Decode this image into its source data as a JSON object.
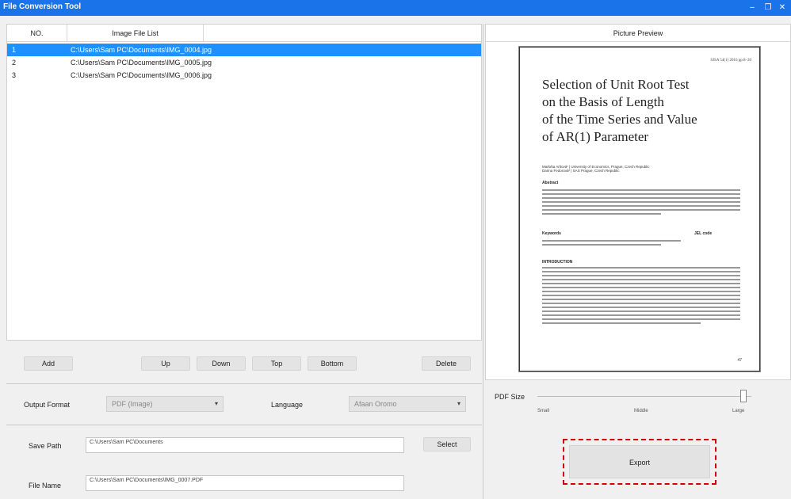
{
  "window": {
    "title": "File Conversion Tool",
    "minimize_glyph": "–",
    "restore_glyph": "❐",
    "close_glyph": "✕"
  },
  "table": {
    "col_no": "NO.",
    "col_file": "Image File List",
    "rows": [
      {
        "no": "1",
        "path": "C:\\Users\\Sam PC\\Documents\\IMG_0004.jpg",
        "selected": true
      },
      {
        "no": "2",
        "path": "C:\\Users\\Sam PC\\Documents\\IMG_0005.jpg",
        "selected": false
      },
      {
        "no": "3",
        "path": "C:\\Users\\Sam PC\\Documents\\IMG_0006.jpg",
        "selected": false
      }
    ]
  },
  "buttons": {
    "add": "Add",
    "up": "Up",
    "down": "Down",
    "top": "Top",
    "bottom": "Bottom",
    "delete": "Delete",
    "select": "Select",
    "export": "Export"
  },
  "preview": {
    "title": "Picture Preview",
    "doc": {
      "header": "SJSA 54(1) 2016 pp.8–20",
      "title_lines": [
        "Selection of Unit Root Test",
        "on the Basis of Length",
        "of the Time Series and Value",
        "of AR(1) Parameter"
      ],
      "authors_line1": "Markéta Arltová¹ | University of Economics, Prague, Czech Republic",
      "authors_line2": "Darina Fedorová² | SAS Prague, Czech Republic",
      "abstract_label": "Abstract",
      "keywords_label": "Keywords",
      "jel_label": "JEL code",
      "intro_label": "INTRODUCTION",
      "page_number": "47"
    }
  },
  "output": {
    "format_label": "Output Format",
    "format_value": "PDF  (Image)",
    "language_label": "Language",
    "language_value": "Afaan Oromo"
  },
  "pdf_size": {
    "label": "PDF Size",
    "ticks": [
      "Small",
      "Middle",
      "Large"
    ],
    "level": 1.0
  },
  "save": {
    "path_label": "Save Path",
    "path_value": "C:\\Users\\Sam PC\\Documents",
    "name_label": "File Name",
    "name_value": "C:\\Users\\Sam PC\\Documents\\IMG_0007.PDF"
  },
  "colors": {
    "accent": "#1a73e8",
    "selection": "#1e90ff",
    "highlight": "#d40000"
  }
}
